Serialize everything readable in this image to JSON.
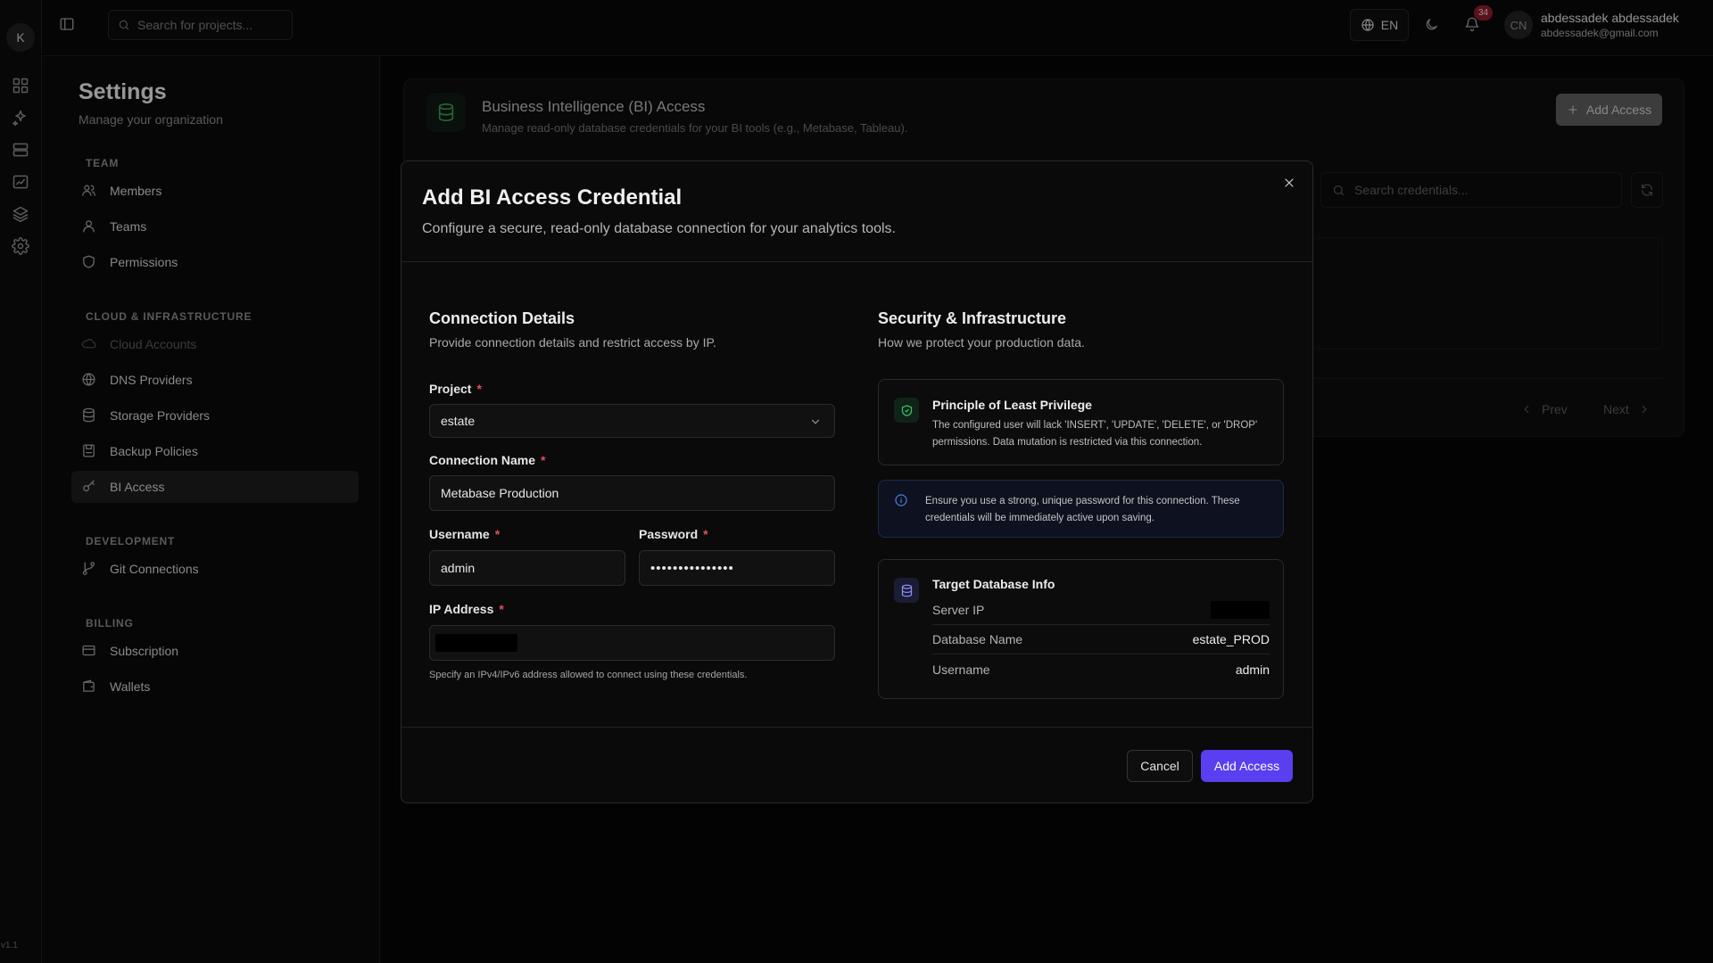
{
  "rail": {
    "logo_letter": "K",
    "icons": [
      "dashboard-icon",
      "sparkles-icon",
      "server-icon",
      "chart-icon",
      "layers-icon",
      "gear-icon"
    ],
    "version": "v1.1"
  },
  "topbar": {
    "search_placeholder": "Search for projects...",
    "language": "EN",
    "notification_count": "34",
    "avatar_initials": "CN",
    "user_name": "abdessadek abdessadek",
    "user_email": "abdessadek@gmail.com"
  },
  "sidebar": {
    "title": "Settings",
    "subtitle": "Manage your organization",
    "sections": [
      {
        "label": "TEAM",
        "items": [
          {
            "label": "Members",
            "icon": "users-icon"
          },
          {
            "label": "Teams",
            "icon": "user-icon"
          },
          {
            "label": "Permissions",
            "icon": "shield-icon"
          }
        ]
      },
      {
        "label": "CLOUD & INFRASTRUCTURE",
        "items": [
          {
            "label": "Cloud Accounts",
            "icon": "cloud-icon",
            "disabled": true
          },
          {
            "label": "DNS Providers",
            "icon": "globe-icon"
          },
          {
            "label": "Storage Providers",
            "icon": "database-icon"
          },
          {
            "label": "Backup Policies",
            "icon": "backup-icon"
          },
          {
            "label": "BI Access",
            "icon": "key-icon",
            "active": true
          }
        ]
      },
      {
        "label": "DEVELOPMENT",
        "items": [
          {
            "label": "Git Connections",
            "icon": "git-branch-icon"
          }
        ]
      },
      {
        "label": "BILLING",
        "items": [
          {
            "label": "Subscription",
            "icon": "credit-card-icon"
          },
          {
            "label": "Wallets",
            "icon": "wallet-icon"
          }
        ]
      }
    ]
  },
  "page": {
    "title": "Business Intelligence (BI) Access",
    "description": "Manage read-only database credentials for your BI tools (e.g., Metabase, Tableau).",
    "add_button": "Add Access",
    "search_placeholder": "Search credentials...",
    "prev": "Prev",
    "next": "Next"
  },
  "modal": {
    "title": "Add BI Access Credential",
    "subtitle": "Configure a secure, read-only database connection for your analytics tools.",
    "connection": {
      "title": "Connection Details",
      "subtitle": "Provide connection details and restrict access by IP.",
      "project_label": "Project",
      "project_value": "estate",
      "name_label": "Connection Name",
      "name_value": "Metabase Production",
      "username_label": "Username",
      "username_value": "admin",
      "password_label": "Password",
      "password_value": "•••••••••••••••",
      "ip_label": "IP Address",
      "ip_hint": "Specify an IPv4/IPv6 address allowed to connect using these credentials.",
      "required_mark": "*"
    },
    "security": {
      "title": "Security & Infrastructure",
      "subtitle": "How we protect your production data.",
      "privilege_title": "Principle of Least Privilege",
      "privilege_text": "The configured user will lack 'INSERT', 'UPDATE', 'DELETE', or 'DROP' permissions. Data mutation is restricted via this connection.",
      "notice_text": "Ensure you use a strong, unique password for this connection. These credentials will be immediately active upon saving.",
      "target_title": "Target Database Info",
      "server_ip_label": "Server IP",
      "db_name_label": "Database Name",
      "db_name_value": "estate_PROD",
      "db_user_label": "Username",
      "db_user_value": "admin"
    },
    "cancel_label": "Cancel",
    "submit_label": "Add Access"
  },
  "colors": {
    "accent": "#5a3ff0",
    "required": "#e0505b",
    "badge": "#8b1e2a",
    "success": "#3a9a58",
    "info": "#4c7fe0"
  }
}
